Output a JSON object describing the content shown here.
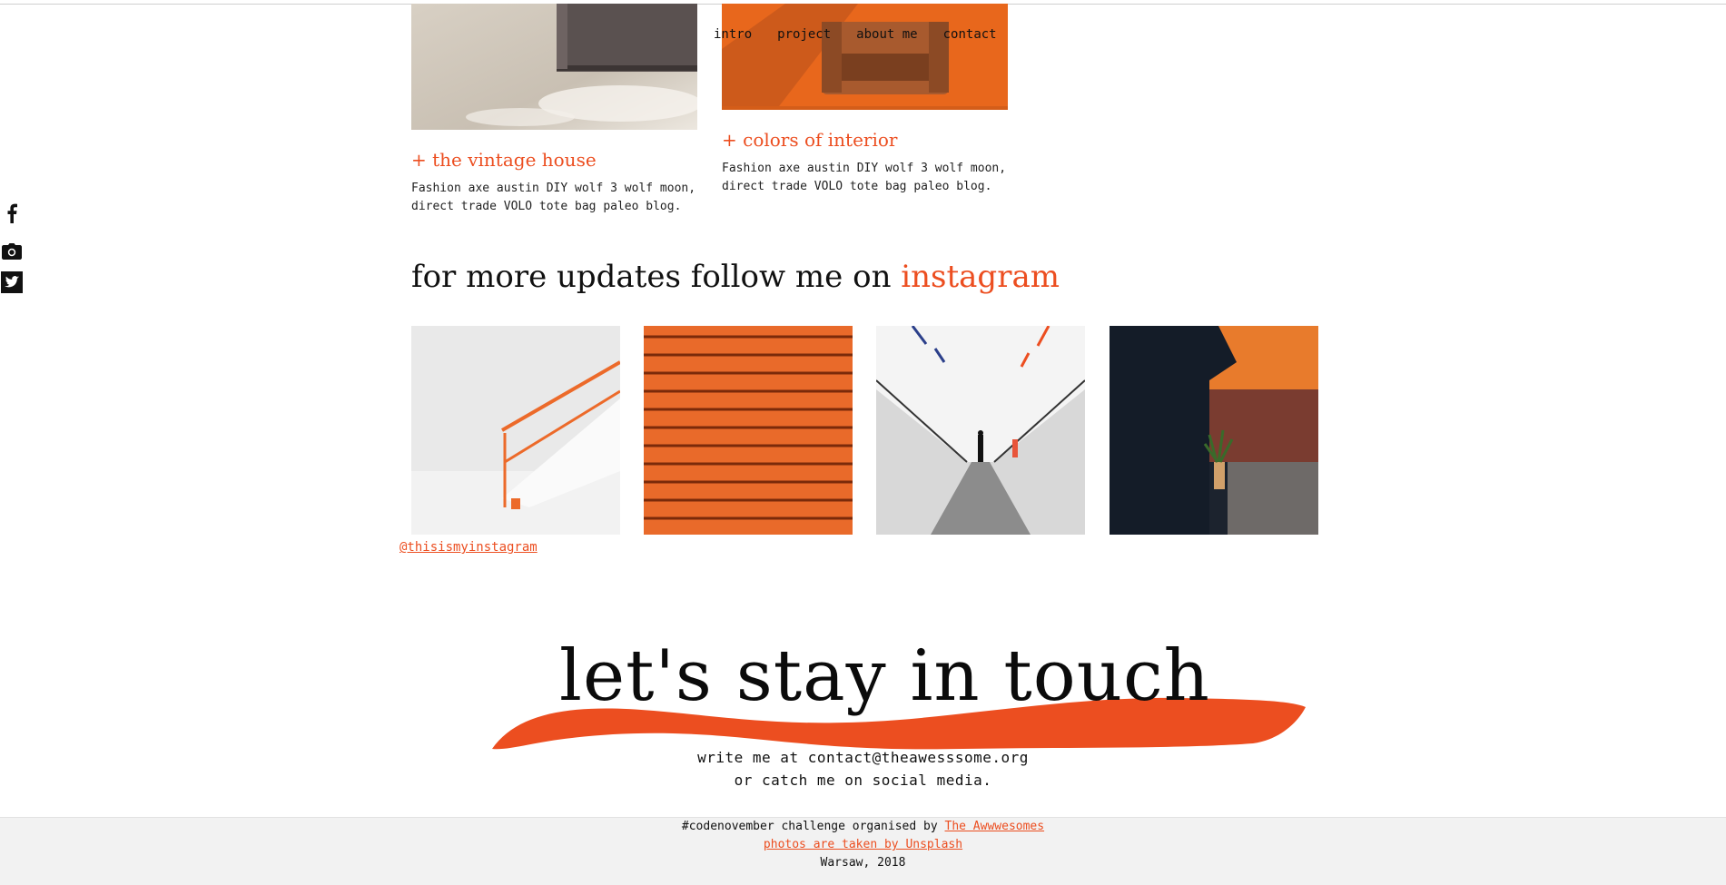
{
  "nav": {
    "items": [
      "intro",
      "project",
      "about me",
      "contact"
    ]
  },
  "social": {
    "icons": [
      "facebook-icon",
      "camera-icon",
      "twitter-icon"
    ]
  },
  "projects": [
    {
      "title": "+ the vintage house",
      "desc": "Fashion axe austin DIY wolf 3 wolf moon, direct trade VOLO tote bag paleo blog."
    },
    {
      "title": "+ colors of interior",
      "desc": "Fashion axe austin DIY wolf 3 wolf moon, direct trade VOLO tote bag paleo blog."
    }
  ],
  "follow": {
    "text": "for more updates follow me on ",
    "accent": "instagram"
  },
  "instagram": {
    "handle": "@thisismyinstagram"
  },
  "touch": {
    "heading": "let's stay in touch",
    "line1": "write me at contact@theawesssome.org",
    "line2": "or catch me on social media."
  },
  "footer": {
    "line1_text": "#codenovember challenge organised by ",
    "line1_link": "The Awwwesomes",
    "line2_link": "photos are taken by Unsplash",
    "line3": "Warsaw, 2018"
  },
  "colors": {
    "accent": "#ec4e20",
    "text": "#111111",
    "footer_bg": "#f2f2f2"
  }
}
